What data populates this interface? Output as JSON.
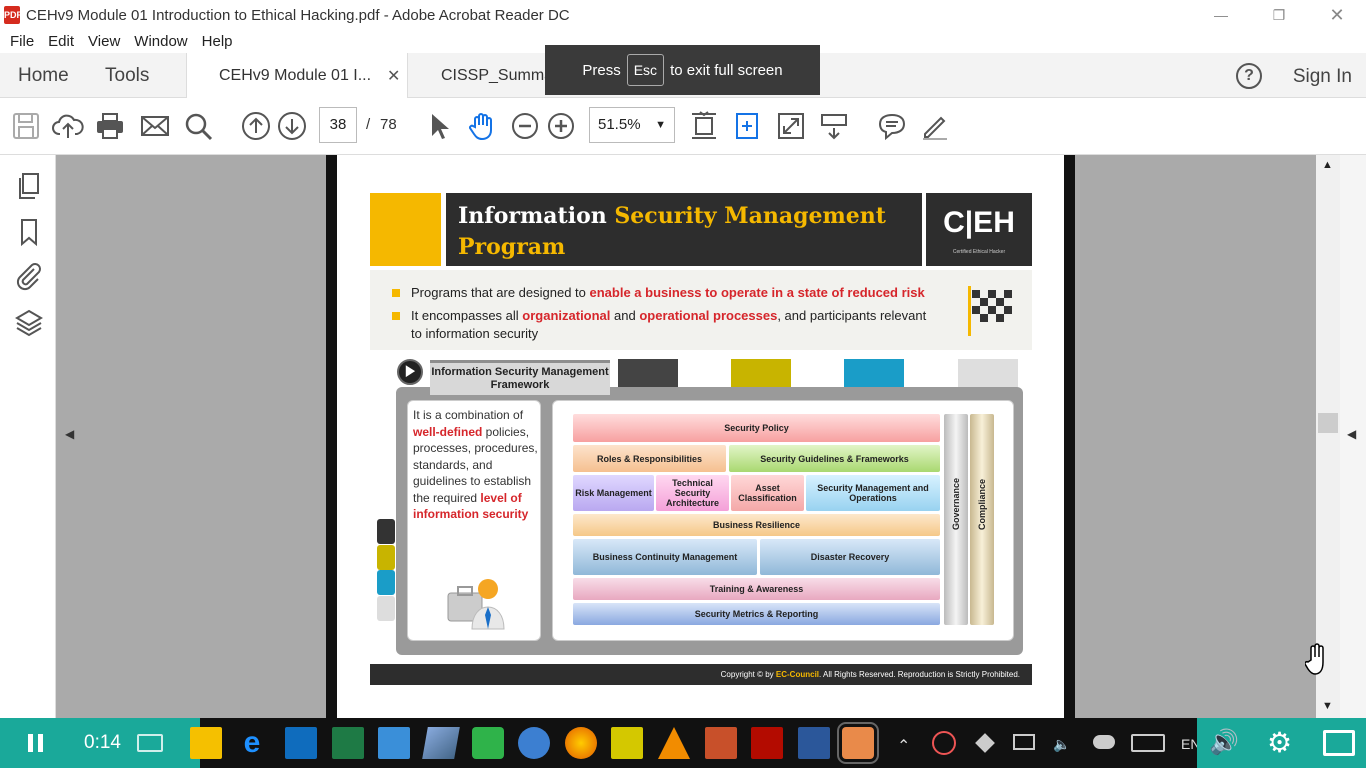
{
  "window": {
    "title": "CEHv9 Module 01 Introduction to Ethical Hacking.pdf - Adobe Acrobat Reader DC",
    "app_icon_label": "PDF"
  },
  "menu": [
    "File",
    "Edit",
    "View",
    "Window",
    "Help"
  ],
  "nav": {
    "home": "Home",
    "tools": "Tools",
    "sign_in": "Sign In",
    "help": "?"
  },
  "tabs": [
    {
      "label": "CEHv9 Module 01 I...",
      "active": true
    },
    {
      "label": "CISSP_Summary_V..."
    }
  ],
  "fullscreen_toast": {
    "press": "Press",
    "key": "Esc",
    "message": "to exit full screen"
  },
  "toolbar": {
    "page_current": "38",
    "page_sep": "/",
    "page_total": "78",
    "zoom": "51.5%"
  },
  "slide": {
    "title_white": "Information",
    "title_yellow_1": "Security Management",
    "title_yellow_2": "Program",
    "logo": "C|EH",
    "logo_sub": "Certified   Ethical   Hacker",
    "bullet1_plain": "Programs that are designed to ",
    "bullet1_red": "enable a business to operate in a state of reduced risk",
    "bullet2_a": "It encompasses all ",
    "bullet2_red1": "organizational",
    "bullet2_b": " and ",
    "bullet2_red2": "operational processes",
    "bullet2_c": ", and participants relevant",
    "bullet2_d": "to information security",
    "framework_tab": "Information Security Management Framework",
    "left_text_1": "It is a combination of",
    "left_red_1": "well-defined",
    "left_text_2": " policies, processes, procedures, standards, and guidelines to establish the required ",
    "left_red_2": "level of information security",
    "blocks": {
      "security_policy": "Security Policy",
      "roles": "Roles & Responsibilities",
      "guidelines": "Security Guidelines & Frameworks",
      "risk": "Risk Management",
      "tech": "Technical Security Architecture",
      "asset": "Asset Classification",
      "secmgmt": "Security Management and Operations",
      "resilience": "Business Resilience",
      "bcm": "Business Continuity Management",
      "dr": "Disaster Recovery",
      "training": "Training & Awareness",
      "metrics": "Security Metrics & Reporting",
      "governance": "Governance",
      "compliance": "Compliance"
    },
    "footer_a": "Copyright © by ",
    "footer_brand": "EC-Council",
    "footer_b": ". All Rights Reserved. Reproduction is Strictly Prohibited."
  },
  "taskbar": {
    "timer": "0:14",
    "lang": "EN"
  },
  "colors": {
    "accent_yellow": "#f5b800",
    "red_text": "#d6262b",
    "teal": "#1aa99a"
  }
}
